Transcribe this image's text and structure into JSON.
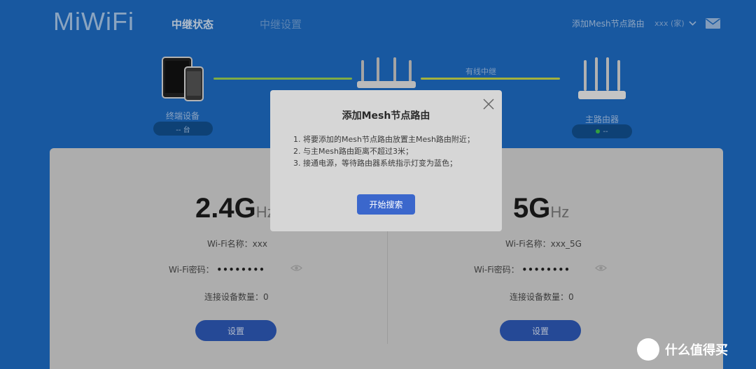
{
  "header": {
    "logo": "MiWiFi",
    "tabs": [
      {
        "label": "中继状态",
        "active": true
      },
      {
        "label": "中继设置",
        "active": false
      }
    ],
    "add_mesh_link": "添加Mesh节点路由",
    "user_name": "xxx (家)"
  },
  "topology": {
    "terminal_label": "终端设备",
    "terminal_count": "-- 台",
    "wired_relay_label": "有线中继",
    "main_router_label": "主路由器",
    "main_router_status": "--"
  },
  "wifi": [
    {
      "band": "2.4G",
      "unit": "Hz",
      "ssid_label": "Wi-Fi名称：",
      "ssid": "xxx",
      "password_label": "Wi-Fi密码：",
      "password_mask": "••••••••",
      "clients_label": "连接设备数量：",
      "clients": "0",
      "settings_button": "设置"
    },
    {
      "band": "5G",
      "unit": "Hz",
      "ssid_label": "Wi-Fi名称：",
      "ssid": "xxx_5G",
      "password_label": "Wi-Fi密码：",
      "password_mask": "••••••••",
      "clients_label": "连接设备数量：",
      "clients": "0",
      "settings_button": "设置"
    }
  ],
  "modal": {
    "title": "添加Mesh节点路由",
    "steps": [
      "1. 将要添加的Mesh节点路由放置主Mesh路由附近；",
      "2. 与主Mesh路由距离不超过3米；",
      "3. 接通电源，等待路由器系统指示灯变为蓝色；"
    ],
    "start_button": "开始搜索"
  },
  "watermark": {
    "text": "什么值得买",
    "badge": "值"
  },
  "colors": {
    "background": "#1e6cc4",
    "link_green": "#9bd154",
    "primary_button": "#3b67cc",
    "status_dot": "#3fc24c"
  }
}
